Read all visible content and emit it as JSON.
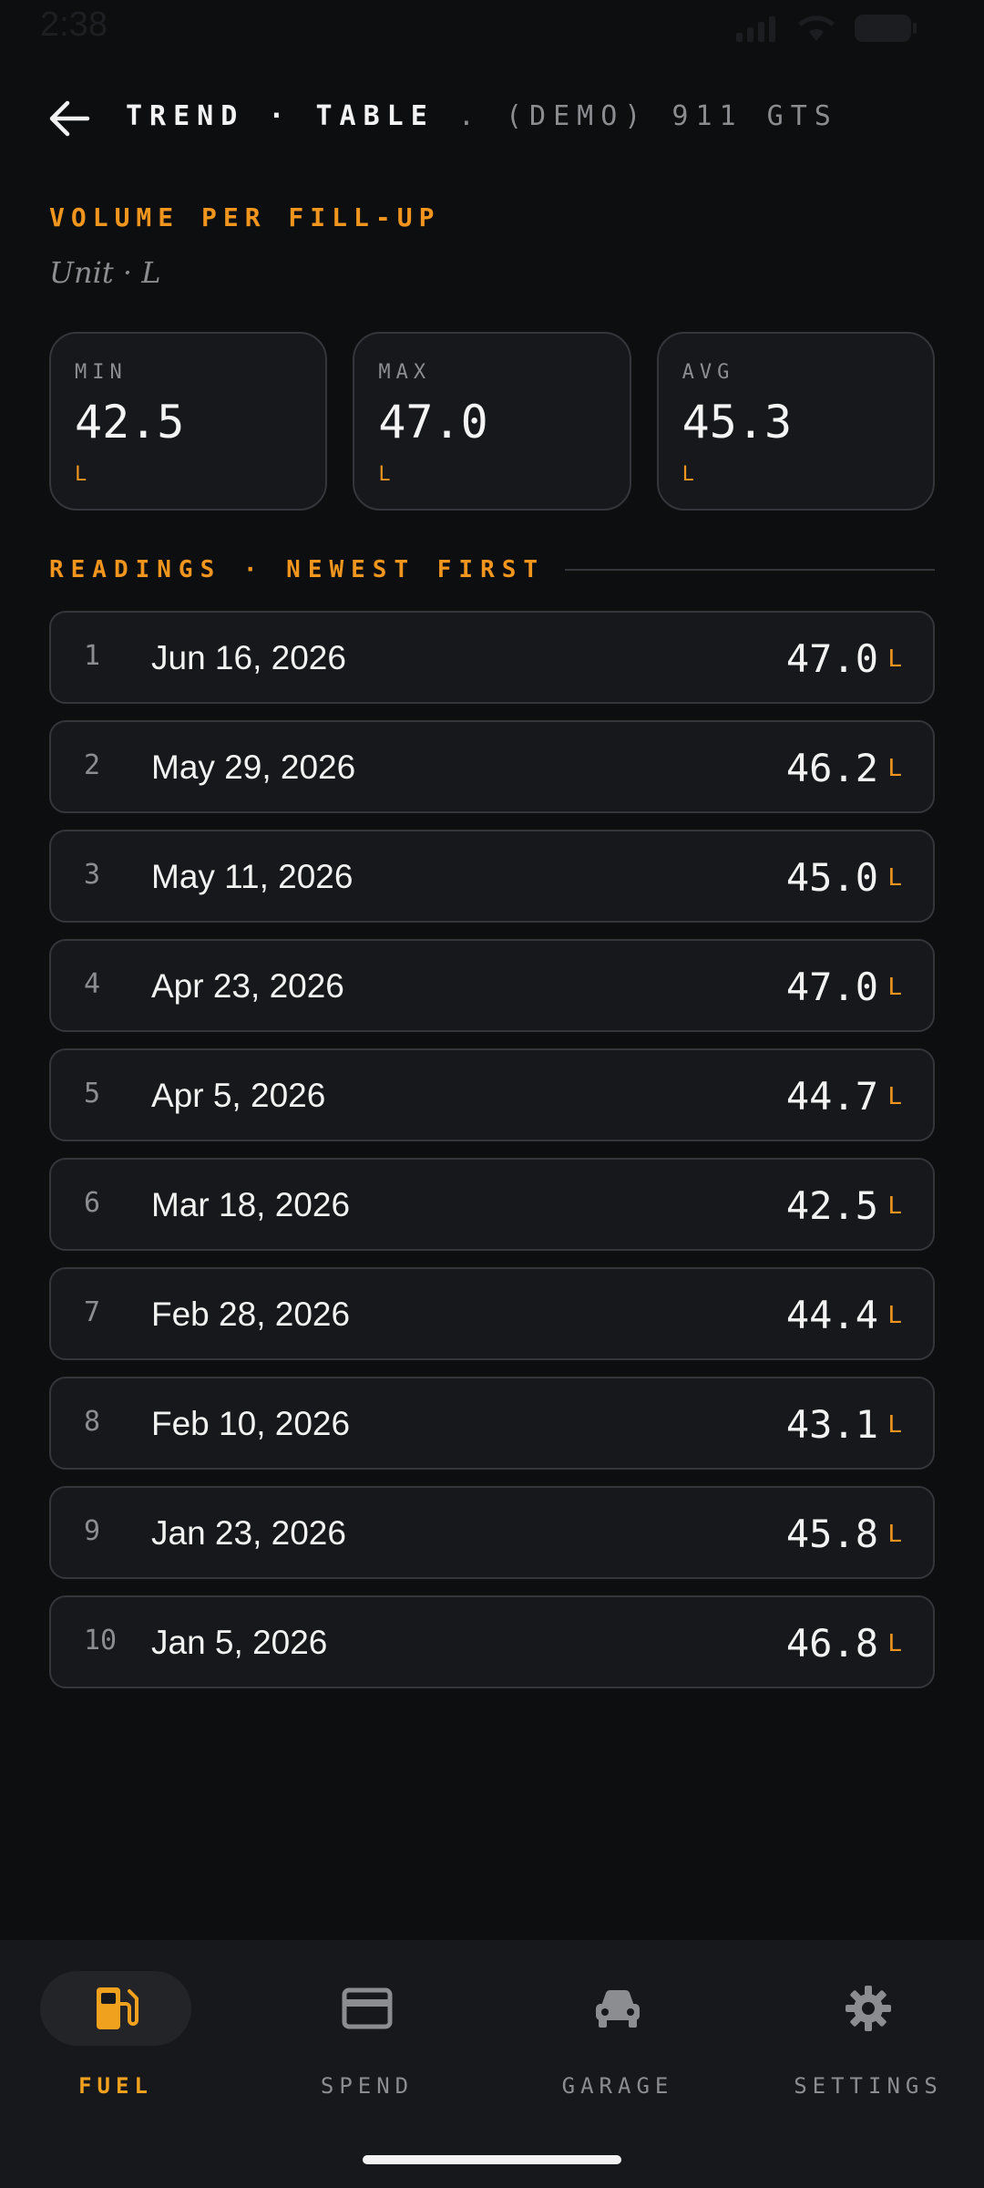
{
  "status": {
    "time": "2:38"
  },
  "header": {
    "title_part1": "TREND · TABLE",
    "title_part2": ". (DEMO) 911 GTS"
  },
  "section": {
    "title": "VOLUME PER FILL-UP",
    "unit_line": "Unit · L"
  },
  "stats": [
    {
      "label": "MIN",
      "value": "42.5",
      "unit": "L"
    },
    {
      "label": "MAX",
      "value": "47.0",
      "unit": "L"
    },
    {
      "label": "AVG",
      "value": "45.3",
      "unit": "L"
    }
  ],
  "readings": {
    "title": "READINGS · NEWEST FIRST",
    "rows": [
      {
        "index": "1",
        "date": "Jun 16, 2026",
        "value": "47.0",
        "unit": "L"
      },
      {
        "index": "2",
        "date": "May 29, 2026",
        "value": "46.2",
        "unit": "L"
      },
      {
        "index": "3",
        "date": "May 11, 2026",
        "value": "45.0",
        "unit": "L"
      },
      {
        "index": "4",
        "date": "Apr 23, 2026",
        "value": "47.0",
        "unit": "L"
      },
      {
        "index": "5",
        "date": "Apr 5, 2026",
        "value": "44.7",
        "unit": "L"
      },
      {
        "index": "6",
        "date": "Mar 18, 2026",
        "value": "42.5",
        "unit": "L"
      },
      {
        "index": "7",
        "date": "Feb 28, 2026",
        "value": "44.4",
        "unit": "L"
      },
      {
        "index": "8",
        "date": "Feb 10, 2026",
        "value": "43.1",
        "unit": "L"
      },
      {
        "index": "9",
        "date": "Jan 23, 2026",
        "value": "45.8",
        "unit": "L"
      },
      {
        "index": "10",
        "date": "Jan 5, 2026",
        "value": "46.8",
        "unit": "L"
      }
    ]
  },
  "nav": [
    {
      "label": "FUEL",
      "icon": "fuel-pump-icon",
      "active": true
    },
    {
      "label": "SPEND",
      "icon": "credit-card-icon",
      "active": false
    },
    {
      "label": "GARAGE",
      "icon": "car-icon",
      "active": false
    },
    {
      "label": "SETTINGS",
      "icon": "gear-icon",
      "active": false
    }
  ],
  "colors": {
    "accent": "#f0951e",
    "background": "#0d0e10",
    "card": "#17181b",
    "border": "#34363b"
  }
}
